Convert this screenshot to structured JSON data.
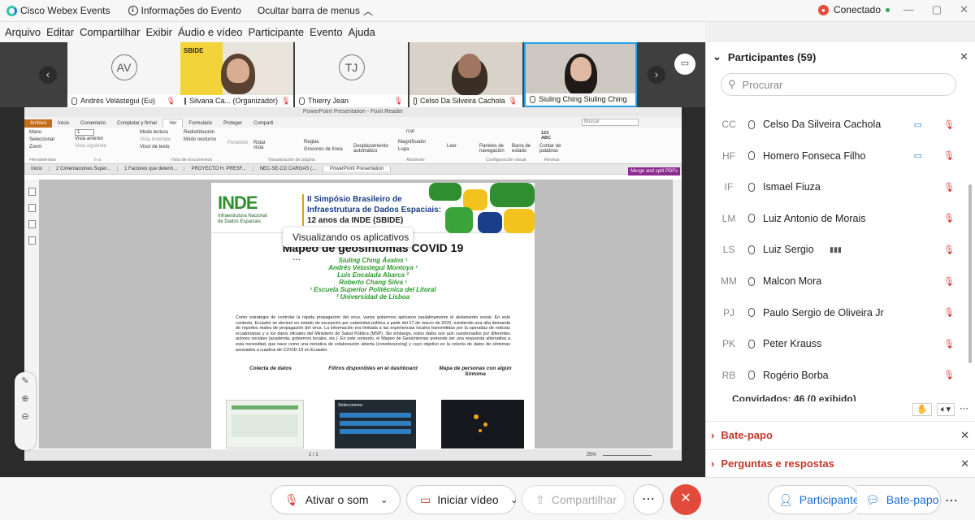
{
  "titlebar": {
    "app_name": "Cisco Webex Events",
    "event_info": "Informações do Evento",
    "hide_menu": "Ocultar barra de menus",
    "status": "Conectado"
  },
  "menu": [
    "Arquivo",
    "Editar",
    "Compartilhar",
    "Exibir",
    "Áudio e vídeo",
    "Participante",
    "Evento",
    "Ajuda"
  ],
  "video_tiles": [
    {
      "initials": "AV",
      "name": "Andrés Velástegui (Eu)"
    },
    {
      "initials": "",
      "name": "Silvana Ca... (Organizador)"
    },
    {
      "initials": "TJ",
      "name": "Thierry Jean"
    },
    {
      "initials": "",
      "name": "Celso Da Silveira Cachola"
    },
    {
      "initials": "",
      "name": "Siuling Ching Siuling Ching"
    }
  ],
  "share_toast": "Visualizando os aplicativos ...",
  "pdf": {
    "window_title": "PowerPoint Presentation - Foxit Reader",
    "tabs": [
      "Archivo",
      "Inicio",
      "Comentario",
      "Completar y firmar",
      "Ver",
      "Formulario",
      "Proteger",
      "Comparti"
    ],
    "ribbon": {
      "g1": [
        "Mano",
        "Seleccionar",
        "Zoom"
      ],
      "g1_name": "Herramientas",
      "g2": [
        "Vista anterior",
        "Vista siguiente"
      ],
      "g2_name": "Ir a",
      "page_input": "1",
      "g3": [
        "Modo lectura",
        "Vista invertida",
        "Visor de texto"
      ],
      "g3b": [
        "Redistribución",
        "Modo nocturno"
      ],
      "portafolio": "Portafolio",
      "g3_name": "Vista de documentos",
      "rotar": "Rotar vista",
      "reglas": [
        "Reglas",
        "Grosores de línea"
      ],
      "g4_name": "Visualización de página",
      "desplaz": "Desplazamiento automático",
      "mag": [
        "Magnificador",
        "Lupa"
      ],
      "leer": "Leer",
      "g5_name": "Asistente",
      "paneles": "Paneles de navegación",
      "barra": "Barra de estado",
      "g6_name": "Configuración visual",
      "contar": "Contar de palabras",
      "g7_name": "Revisar",
      "search_placeholder": "Buscar",
      "icon_count": "123 ABC",
      "partial_cut": "rcar"
    },
    "doc_tabs": [
      "Inicio",
      "2 Cimentaciones Super...",
      "1 Factores que determ...",
      "PROYECTO H. PRESF...",
      "NEC-SE-CG CARGAS (...",
      "PowerPoint Presentation"
    ],
    "merge": "Merge and split PDFs",
    "page_counter": "1 / 1",
    "zoom": "25%"
  },
  "slide": {
    "logo_big": "INDE",
    "logo_small": [
      "Infraestrutura Nacional",
      "de Dados Espaciais"
    ],
    "symposium": [
      "II Simpósio Brasileiro de",
      "Infraestrutura de Dados Espaciais:",
      "12 anos da INDE (SBIDE)"
    ],
    "title": "Mapeo de geosíntomas COVID 19",
    "authors": [
      "Siuling Ching Ávalos ¹",
      "Andrés Velastegui Montoya ¹",
      "Luis Encalada Abarca ²",
      "Roberto Chang Silva ¹",
      "¹ Escuela Superior Politécnica del Litoral",
      "² Universidad de Lisboa"
    ],
    "abstract": "Como estrategia de controlar la rápida propagación del virus, varios gobiernos aplicaron paulatinamente el aislamiento social. En este contexto, Ecuador se declaró en estado de excepción por calamidad pública a partir del 17 de marzo de 2020, existiendo una alta demanda de reportes reales de propagación del virus. La información era limitada a las experiencias locales transmitidas por la operadas de noticias ecuatorianas y a los datos oficiales del Ministerio de Salud Pública (MSP). Sin embargo, estos datos son aún cuestionados por diferentes actores sociales (academia, gobiernos locales, etc.). En este contexto, el Mapeo de Geosíntomas pretende ser una respuesta alternativa a esta necesidad, que nace como una iniciativa de colaboración abierta (crowdsourcing) y cuyo objetivo es la colecta de datos de síntomas asociados a cuadros de COVID-19 en Ecuador.",
    "sections": [
      "Colecta de datos",
      "Filtros disponibles en el dashboard",
      "Mapa de personas con algún Síntoma"
    ],
    "dash_label": "Selecciones:"
  },
  "controls": {
    "mute": "Ativar o som",
    "video": "Iniciar vídeo",
    "share": "Compartilhar",
    "participants": "Participantes",
    "chat": "Bate-papo"
  },
  "panel": {
    "title": "Participantes (59)",
    "search_placeholder": "Procurar",
    "participants": [
      {
        "initials": "CC",
        "name": "Celso Da Silveira Cachola",
        "video": true
      },
      {
        "initials": "HF",
        "name": "Homero Fonseca Filho",
        "video": true
      },
      {
        "initials": "IF",
        "name": "Ismael Fiuza",
        "video": false
      },
      {
        "initials": "LM",
        "name": "Luiz Antonio de Morais",
        "video": false
      },
      {
        "initials": "LS",
        "name": "Luiz Sergio",
        "video": false
      },
      {
        "initials": "MM",
        "name": "Malcon Mora",
        "video": false
      },
      {
        "initials": "PJ",
        "name": "Paulo Sergio de Oliveira Jr",
        "video": false
      },
      {
        "initials": "PK",
        "name": "Peter Krauss",
        "video": false
      },
      {
        "initials": "RB",
        "name": "Rogério Borba",
        "video": false
      }
    ],
    "guests": "Convidados: 46 (0 exibido)",
    "chat_section": "Bate-papo",
    "qa_section": "Perguntas e respostas"
  },
  "colors": {
    "accent_blue": "#1d7cf2",
    "mute_red": "#d33b2c",
    "inde_green": "#2f8f30",
    "foxit_orange": "#c36d1a"
  }
}
